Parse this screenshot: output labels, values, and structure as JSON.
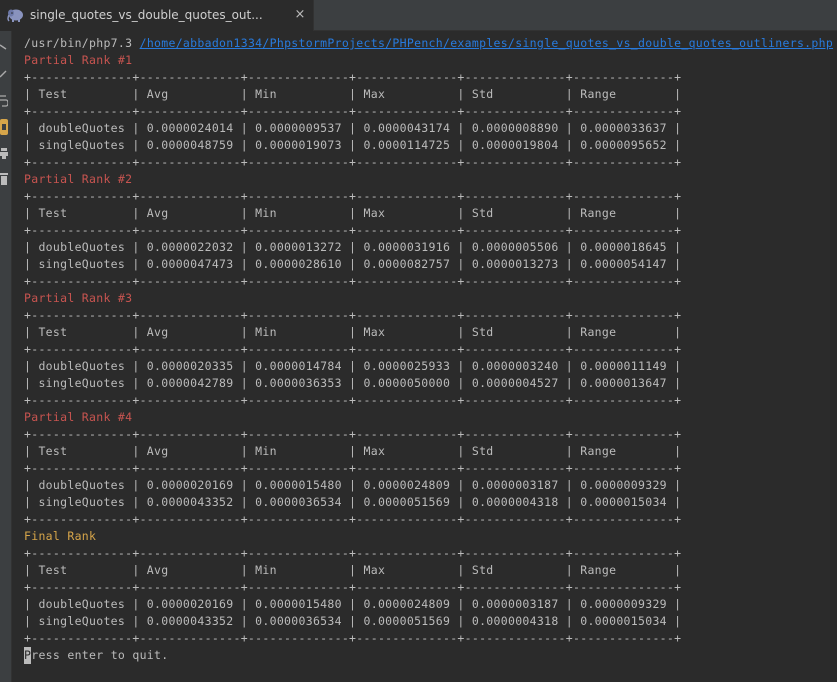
{
  "tab": {
    "title": "single_quotes_vs_double_quotes_out...",
    "close_glyph": "×",
    "icon": "php-elephant-icon"
  },
  "gutter": {
    "icons": [
      "rerun-icon",
      "soft-wrap-icon",
      "scroll-to-end-icon",
      "highlight-icon",
      "print-icon",
      "trash-icon"
    ]
  },
  "colors": {
    "background": "#2b2b2b",
    "text": "#bbbbbb",
    "link": "#287bde",
    "partial_rank": "#c75450",
    "final_rank": "#d6a54a"
  },
  "console": {
    "command": "/usr/bin/php7.3",
    "script_path": "/home/abbadon1334/PhpstormProjects/PHPench/examples/single_quotes_vs_double_quotes_outliners.php",
    "separator": "+--------------+--------------+--------------+--------------+--------------+--------------+",
    "header_row": "| Test         | Avg          | Min          | Max          | Std          | Range        |",
    "sections": [
      {
        "title": "Partial Rank #1",
        "rows": [
          "| doubleQuotes | 0.0000024014 | 0.0000009537 | 0.0000043174 | 0.0000008890 | 0.0000033637 |",
          "| singleQuotes | 0.0000048759 | 0.0000019073 | 0.0000114725 | 0.0000019804 | 0.0000095652 |"
        ]
      },
      {
        "title": "Partial Rank #2",
        "rows": [
          "| doubleQuotes | 0.0000022032 | 0.0000013272 | 0.0000031916 | 0.0000005506 | 0.0000018645 |",
          "| singleQuotes | 0.0000047473 | 0.0000028610 | 0.0000082757 | 0.0000013273 | 0.0000054147 |"
        ]
      },
      {
        "title": "Partial Rank #3",
        "rows": [
          "| doubleQuotes | 0.0000020335 | 0.0000014784 | 0.0000025933 | 0.0000003240 | 0.0000011149 |",
          "| singleQuotes | 0.0000042789 | 0.0000036353 | 0.0000050000 | 0.0000004527 | 0.0000013647 |"
        ]
      },
      {
        "title": "Partial Rank #4",
        "rows": [
          "| doubleQuotes | 0.0000020169 | 0.0000015480 | 0.0000024809 | 0.0000003187 | 0.0000009329 |",
          "| singleQuotes | 0.0000043352 | 0.0000036534 | 0.0000051569 | 0.0000004318 | 0.0000015034 |"
        ]
      },
      {
        "title": "Final Rank",
        "rows": [
          "| doubleQuotes | 0.0000020169 | 0.0000015480 | 0.0000024809 | 0.0000003187 | 0.0000009329 |",
          "| singleQuotes | 0.0000043352 | 0.0000036534 | 0.0000051569 | 0.0000004318 | 0.0000015034 |"
        ]
      }
    ],
    "prompt_cursor_char": "P",
    "prompt_rest": "ress enter to quit."
  }
}
